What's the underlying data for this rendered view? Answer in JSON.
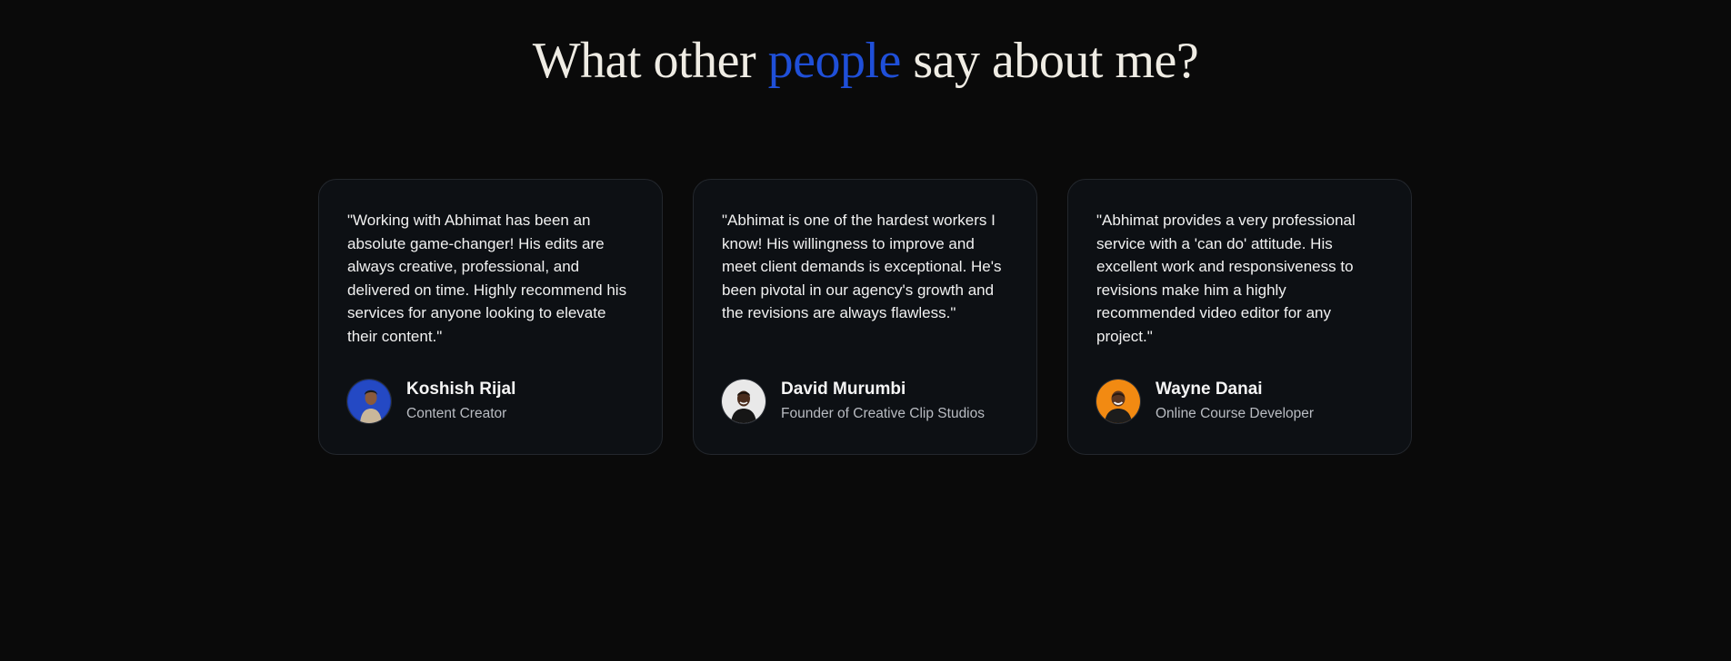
{
  "heading": {
    "before": "What other ",
    "accent": "people",
    "after": " say about me?"
  },
  "colors": {
    "background": "#0a0a0a",
    "card_background": "#0d1014",
    "accent": "#1f4fd8"
  },
  "testimonials": [
    {
      "quote": "\"Working with Abhimat has been an absolute game-changer! His edits are always creative, professional, and delivered on time. Highly recommend his services for anyone looking to elevate their content.\"",
      "name": "Koshish Rijal",
      "role": "Content Creator",
      "avatar_bg": "#1d3fae"
    },
    {
      "quote": "\"Abhimat is one of the hardest workers I know! His willingness to improve and meet client demands is exceptional. He's been pivotal in our agency's growth and the revisions are always flawless.\"",
      "name": "David Murumbi",
      "role": "Founder of Creative Clip Studios",
      "avatar_bg": "#e9e9e9"
    },
    {
      "quote": "\"Abhimat provides a very professional service with a 'can do' attitude. His excellent work and responsiveness to revisions make him a highly recommended video editor for any project.\"",
      "name": "Wayne Danai",
      "role": "Online Course Developer",
      "avatar_bg": "#f28a12"
    }
  ]
}
